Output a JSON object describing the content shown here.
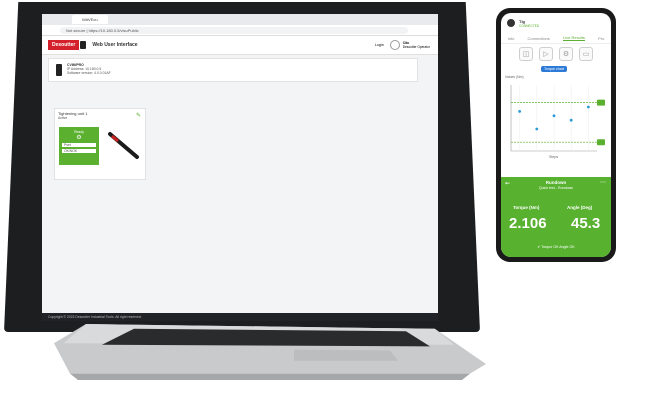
{
  "browser": {
    "tab_title": "WAVEcu",
    "url": "Not secure | https://10.180.0.5/visuPublic"
  },
  "app": {
    "logo": "Desoutter",
    "title": "Web User Interface",
    "login": "Login",
    "user_label": "Cito",
    "user_sub": "Desoutter Operator"
  },
  "controller": {
    "name": "CVIM/PRO",
    "line1": "IP Address: 10.180.0.5",
    "line2": "Software version: 4.0.0.01AF"
  },
  "tool_card": {
    "title": "Tightening unit 1",
    "subtitle": "Active",
    "gun_label": "Ready",
    "rows": [
      "Pset",
      "OK/NOK"
    ]
  },
  "footer": "Copyright © 2023 Desoutter Industrial Tools. All right reserved.",
  "phone": {
    "status_title": "Tlg",
    "status_sub": "CONNECTED",
    "tabs": [
      "Info",
      "Connections",
      "Live Results",
      "Pro"
    ],
    "active_tab": "Live Results",
    "chart_label": "Torque chart",
    "y_axis_label": "Values (Nm)",
    "x_axis_label": "Steps",
    "result_header": "Rundown",
    "result_sub": "Quick test - Rundown",
    "torque_label": "Torque (Nm)",
    "angle_label": "Angle (Deg)",
    "torque_value": "2.106",
    "angle_value": "45.3",
    "status_line": "Torque OK Angle OK"
  },
  "colors": {
    "brand_red": "#d3202b",
    "accent_green": "#5bb030",
    "laptop_body": "#1d1e20"
  },
  "chart_data": {
    "type": "scatter",
    "x": [
      1,
      2,
      3,
      4,
      5
    ],
    "y": [
      2.4,
      2.0,
      2.3,
      2.2,
      2.5
    ],
    "xlabel": "Steps",
    "ylabel": "Values (Nm)",
    "ylim": [
      1.5,
      3.0
    ],
    "thresholds": [
      1.7,
      2.6
    ]
  }
}
